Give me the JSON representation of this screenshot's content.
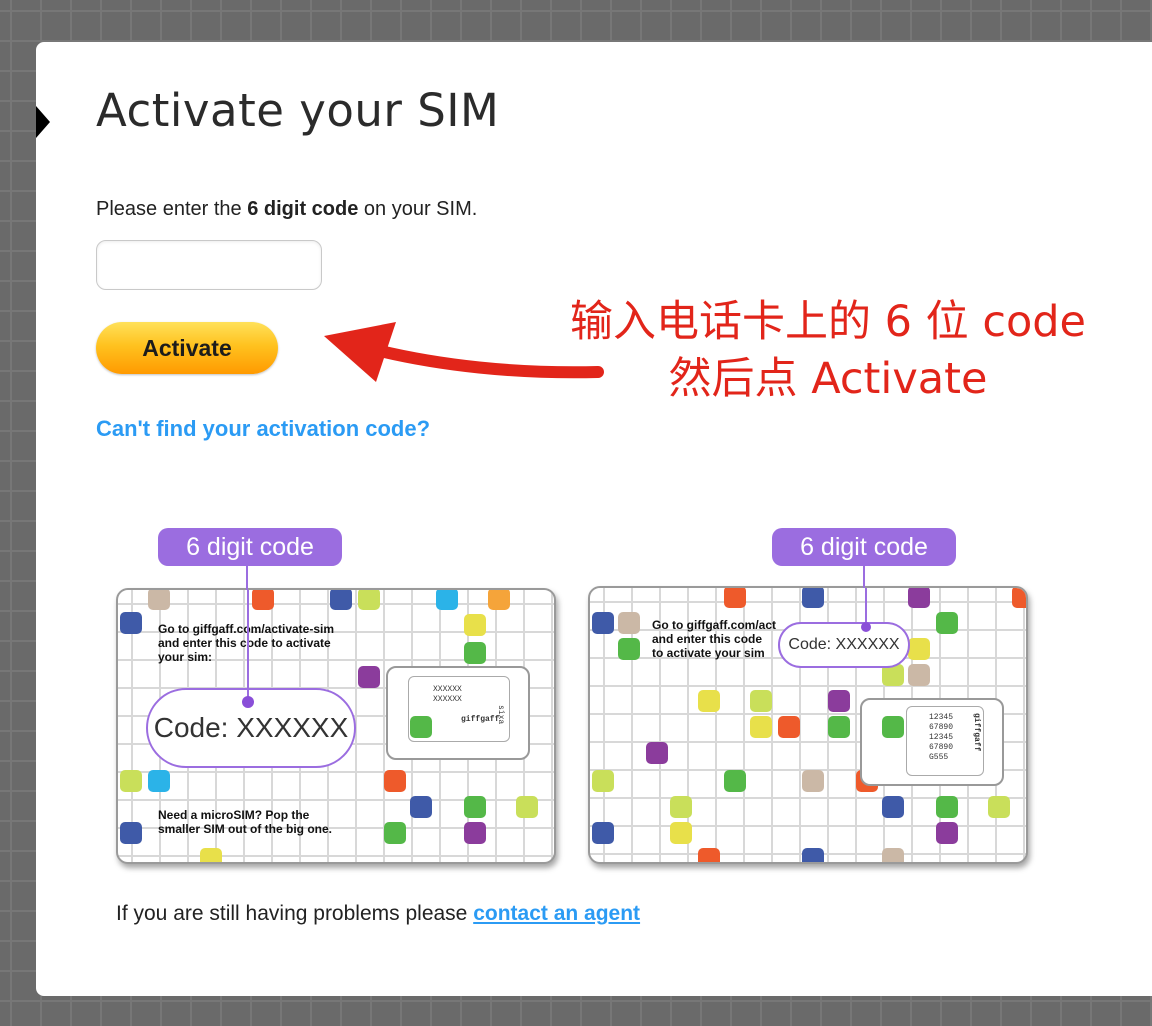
{
  "page": {
    "title": "Activate your SIM",
    "instruction_prefix": "Please enter the ",
    "instruction_bold": "6 digit code",
    "instruction_suffix": " on your SIM.",
    "code_input_value": "",
    "activate_label": "Activate",
    "cant_find_link": "Can't find your activation code?",
    "bottom_prefix": "If you are still having problems please ",
    "bottom_link": "contact an agent"
  },
  "annotation": {
    "line1": "输入电话卡上的 6 位 code",
    "line2": "然后点 Activate",
    "color": "#e2251a"
  },
  "sim_left": {
    "label": "6 digit code",
    "text_top": [
      "Go to giffgaff.com/activate-sim",
      "and enter this code to activate",
      "your sim:"
    ],
    "code": "Code: XXXXXX",
    "text_bottom": [
      "Need a microSIM? Pop the",
      "smaller SIM out of the big one."
    ],
    "chip_lines": [
      "XXXXXX",
      "XXXXXX"
    ],
    "chip_brand": "giffgaff",
    "chip_side": "sixa"
  },
  "sim_right": {
    "label": "6 digit code",
    "text_top": [
      "Go to giffgaff.com/act",
      "and enter this code",
      "to activate your sim"
    ],
    "code": "Code: XXXXXX",
    "chip_lines": [
      "12345",
      "67890",
      "12345",
      "67890",
      "G555"
    ],
    "chip_brand": "giffgaff"
  },
  "colors": {
    "accent_blue": "#2b9bf4",
    "label_purple": "#9b6de0",
    "button_orange": "#ffb000"
  }
}
